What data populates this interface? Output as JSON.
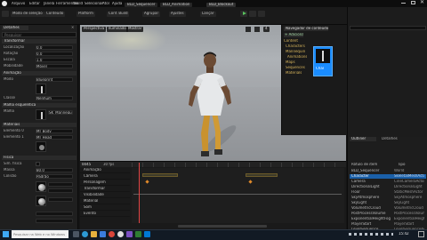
{
  "app": {
    "menu": [
      "Arquivo",
      "Editar",
      "Janela",
      "Ferramentas",
      "Build",
      "Selecionar",
      "Ator",
      "Ajuda"
    ],
    "doc_tabs": [
      "BLD_Sequencer",
      "BLD_Animation",
      "BLD_Blockout"
    ],
    "toolbar_items": [
      "Modo de seleção",
      "Conteúdo",
      "Platform",
      "Conf. Build",
      "Agrupar",
      "Ajustes",
      "Lançar"
    ]
  },
  "details": {
    "tab": "Detalhes",
    "search_placeholder": "Pesquisar",
    "sections": [
      "Transformar",
      "Animação",
      "Malha esquelética",
      "Materiais",
      "Física"
    ],
    "rows": [
      {
        "label": "Localização",
        "value": "0.0"
      },
      {
        "label": "Rotação",
        "value": "0.0"
      },
      {
        "label": "Escala",
        "value": "1.0"
      },
      {
        "label": "Mobilidade",
        "value": "Móvel"
      },
      {
        "label": "Modo",
        "value": "Blueprint"
      },
      {
        "label": "Classe",
        "value": "Nenhum"
      },
      {
        "label": "Malha",
        "value": "SK_Mannequin"
      },
      {
        "label": "Elemento 0",
        "value": "MI_Body"
      },
      {
        "label": "Elemento 1",
        "value": "MI_Head"
      },
      {
        "label": "Sim. física",
        "value": ""
      },
      {
        "label": "Massa",
        "value": "80.0"
      },
      {
        "label": "Colisão",
        "value": "Padrão"
      }
    ]
  },
  "viewport": {
    "buttons": [
      "Perspectiva",
      "Iluminado",
      "Mostrar"
    ],
    "speed": "4"
  },
  "content_browser": {
    "title": "Navegador de conteúdo",
    "add_label": "+ Adicionar",
    "folders": [
      "Content",
      "Characters",
      "Mannequin",
      "Animations",
      "Maps",
      "Sequences",
      "Materials"
    ],
    "selected_asset": "Char"
  },
  "outliner": {
    "tab_a": "Outliner",
    "tab_b": "Detalhes",
    "header_label": "Rótulo de item",
    "header_type": "Tipo",
    "rows": [
      {
        "name": "BLD_Sequencer",
        "type": "World",
        "selected": false
      },
      {
        "name": "Character",
        "type": "SkeletalMeshActor",
        "selected": true
      },
      {
        "name": "Camera",
        "type": "CineCameraActor",
        "selected": false
      },
      {
        "name": "DirectionalLight",
        "type": "DirectionalLight",
        "selected": false
      },
      {
        "name": "Floor",
        "type": "StaticMeshActor",
        "selected": false
      },
      {
        "name": "SkyAtmosphere",
        "type": "SkyAtmosphere",
        "selected": false
      },
      {
        "name": "SkyLight",
        "type": "SkyLight",
        "selected": false
      },
      {
        "name": "VolumetricCloud",
        "type": "VolumetricCloud",
        "selected": false
      },
      {
        "name": "PostProcessVolume",
        "type": "PostProcessVolume",
        "selected": false
      },
      {
        "name": "ExponentialHeightFog",
        "type": "ExponentialHeightFog",
        "selected": false
      },
      {
        "name": "PlayerStart",
        "type": "PlayerStart",
        "selected": false
      },
      {
        "name": "LevelSequence",
        "type": "LevelSequenceActor",
        "selected": false
      }
    ]
  },
  "sequencer": {
    "tracks": [
      "Animação",
      "Câmera",
      "Personagem",
      "Transformar",
      "Visibilidade",
      "Material",
      "Som",
      "Evento"
    ],
    "time": "0045",
    "fps": "30 fps"
  },
  "taskbar": {
    "search_placeholder": "Pesquisar na Web e no Windows",
    "clock": "15:42"
  },
  "colors": {
    "accent": "#1a8cff",
    "key": "#e08a2a"
  }
}
